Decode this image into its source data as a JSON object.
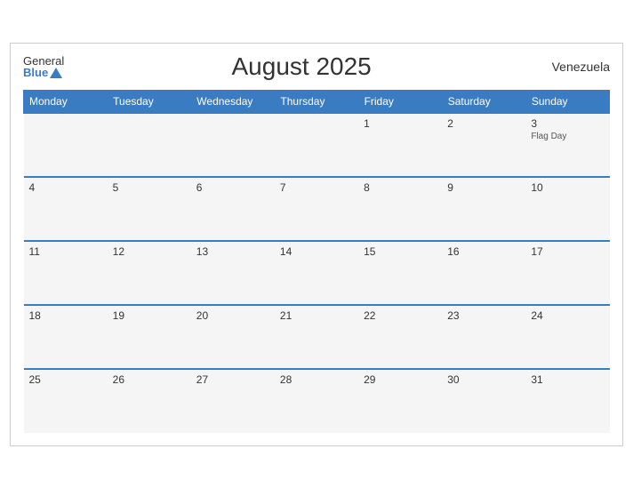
{
  "header": {
    "logo_general": "General",
    "logo_blue": "Blue",
    "title": "August 2025",
    "country": "Venezuela"
  },
  "weekdays": [
    "Monday",
    "Tuesday",
    "Wednesday",
    "Thursday",
    "Friday",
    "Saturday",
    "Sunday"
  ],
  "weeks": [
    [
      {
        "day": "",
        "event": ""
      },
      {
        "day": "",
        "event": ""
      },
      {
        "day": "",
        "event": ""
      },
      {
        "day": "",
        "event": ""
      },
      {
        "day": "1",
        "event": ""
      },
      {
        "day": "2",
        "event": ""
      },
      {
        "day": "3",
        "event": "Flag Day"
      }
    ],
    [
      {
        "day": "4",
        "event": ""
      },
      {
        "day": "5",
        "event": ""
      },
      {
        "day": "6",
        "event": ""
      },
      {
        "day": "7",
        "event": ""
      },
      {
        "day": "8",
        "event": ""
      },
      {
        "day": "9",
        "event": ""
      },
      {
        "day": "10",
        "event": ""
      }
    ],
    [
      {
        "day": "11",
        "event": ""
      },
      {
        "day": "12",
        "event": ""
      },
      {
        "day": "13",
        "event": ""
      },
      {
        "day": "14",
        "event": ""
      },
      {
        "day": "15",
        "event": ""
      },
      {
        "day": "16",
        "event": ""
      },
      {
        "day": "17",
        "event": ""
      }
    ],
    [
      {
        "day": "18",
        "event": ""
      },
      {
        "day": "19",
        "event": ""
      },
      {
        "day": "20",
        "event": ""
      },
      {
        "day": "21",
        "event": ""
      },
      {
        "day": "22",
        "event": ""
      },
      {
        "day": "23",
        "event": ""
      },
      {
        "day": "24",
        "event": ""
      }
    ],
    [
      {
        "day": "25",
        "event": ""
      },
      {
        "day": "26",
        "event": ""
      },
      {
        "day": "27",
        "event": ""
      },
      {
        "day": "28",
        "event": ""
      },
      {
        "day": "29",
        "event": ""
      },
      {
        "day": "30",
        "event": ""
      },
      {
        "day": "31",
        "event": ""
      }
    ]
  ]
}
